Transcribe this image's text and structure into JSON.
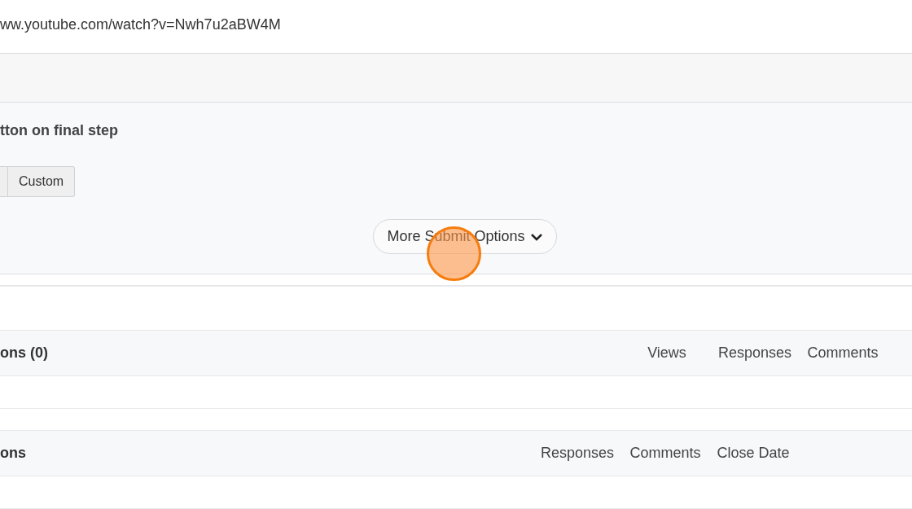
{
  "address_bar": {
    "url": "ww.youtube.com/watch?v=Nwh7u2aBW4M"
  },
  "submit_panel": {
    "heading": "tton on final step",
    "buttons": [
      "Custom"
    ],
    "more_button": {
      "label": "More Submit Options"
    }
  },
  "tables": [
    {
      "title": "ons (0)",
      "columns": [
        "Views",
        "Responses",
        "Comments"
      ],
      "trailing_space": false
    },
    {
      "title": "ons",
      "columns": [
        "Responses",
        "Comments",
        "Close Date"
      ],
      "trailing_space": true
    }
  ]
}
